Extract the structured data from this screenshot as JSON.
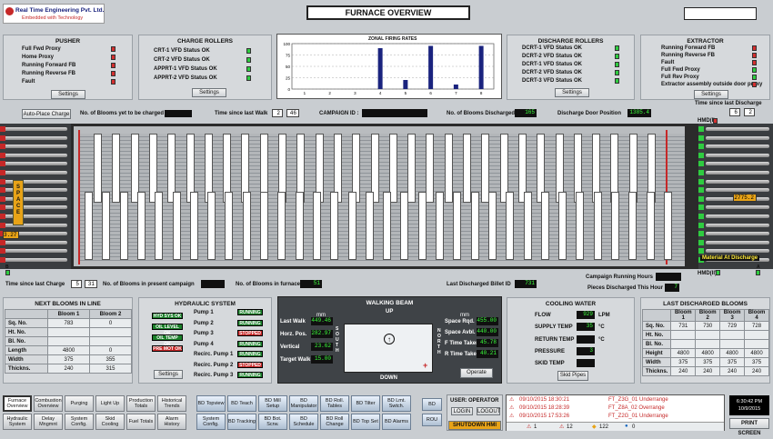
{
  "company": {
    "name": "Real Time Engineering Pvt. Ltd.",
    "tagline": "Embedded with Technology"
  },
  "page_title": "FURNACE OVERVIEW",
  "pusher": {
    "title": "PUSHER",
    "items": [
      {
        "label": "Full Fwd Proxy",
        "state": "red"
      },
      {
        "label": "Home Proxy",
        "state": "red"
      },
      {
        "label": "Running Forward FB",
        "state": "red"
      },
      {
        "label": "Running Reverse FB",
        "state": "red"
      },
      {
        "label": "Fault",
        "state": "red"
      }
    ],
    "settings": "Settings"
  },
  "charge_rollers": {
    "title": "CHARGE ROLLERS",
    "items": [
      {
        "label": "CRT-1 VFD Status OK",
        "state": "green"
      },
      {
        "label": "CRT-2 VFD Status OK",
        "state": "green"
      },
      {
        "label": "APPRT-1 VFD Status OK",
        "state": "green"
      },
      {
        "label": "APPRT-2 VFD Status OK",
        "state": "green"
      }
    ],
    "settings": "Settings"
  },
  "zonal_chart": {
    "chart_data": {
      "type": "bar",
      "title": "ZONAL FIRING RATES",
      "categories": [
        "1",
        "2",
        "3",
        "4",
        "5",
        "6",
        "7",
        "8"
      ],
      "values": [
        0,
        0,
        0,
        90,
        20,
        95,
        10,
        95
      ],
      "ylim": [
        0,
        100
      ],
      "yticks": [
        "100",
        "75",
        "50",
        "25",
        "0"
      ]
    }
  },
  "discharge_rollers": {
    "title": "DISCHARGE ROLLERS",
    "items": [
      {
        "label": "DCRT-1 VFD Status OK",
        "state": "green"
      },
      {
        "label": "DCRT-2 VFD Status OK",
        "state": "green"
      },
      {
        "label": "DCRT-1 VFD Status OK",
        "state": "green"
      },
      {
        "label": "DCRT-2 VFD Status OK",
        "state": "green"
      },
      {
        "label": "DCRT-3 VFD Status OK",
        "state": "green"
      }
    ],
    "settings": "Settings"
  },
  "extractor": {
    "title": "EXTRACTOR",
    "items": [
      {
        "label": "Running Forward FB",
        "state": "red"
      },
      {
        "label": "Running Reverse FB",
        "state": "red"
      },
      {
        "label": "Fault",
        "state": "red"
      },
      {
        "label": "Full Fwd Proxy",
        "state": "green"
      },
      {
        "label": "Full Rev Proxy",
        "state": "green"
      },
      {
        "label": "Extractor assembly outside door proxy",
        "state": "red"
      }
    ],
    "settings": "Settings"
  },
  "top_status": {
    "auto_place": "Auto-Place Charge",
    "blooms_to_charge_label": "No. of Blooms yet to be charged",
    "blooms_to_charge": "",
    "since_last_walk_label": "Time since last Walk",
    "since_last_walk_m": "2",
    "since_last_walk_s": "46",
    "campaign_id_label": "CAMPAIGN ID :",
    "campaign_id": "",
    "blooms_discharged_label": "No. of Blooms Discharged",
    "blooms_discharged": "165",
    "door_pos_label": "Discharge Door Position",
    "door_pos": "1385.4",
    "since_last_discharge_label": "Time since last Discharge",
    "since_last_discharge_m": "6",
    "since_last_discharge_s": "2"
  },
  "furnace": {
    "space_label": "SPACE",
    "left_value": "3.27",
    "right_value": "2775.2",
    "hmd_i": "HMD(I)",
    "hmd_ii": "HMD(II)",
    "material_at_discharge": "Material At Discharge",
    "a_label": "A",
    "b_label": "B"
  },
  "bottom_status": {
    "since_last_charge_label": "Time since last Charge",
    "since_last_charge_m": "5",
    "since_last_charge_s": "31",
    "blooms_campaign_label": "No. of Blooms in present campaign",
    "blooms_campaign": "",
    "blooms_furnace_label": "No. of Blooms in furnace",
    "blooms_furnace": "51",
    "last_billet_label": "Last Discharged Billet ID",
    "last_billet": "731",
    "campaign_hours_label": "Campaign Running Hours",
    "campaign_hours": "",
    "pieces_hour_label": "Pieces Discharged This Hour",
    "pieces_hour": "7"
  },
  "next_blooms": {
    "title": "NEXT BLOOMS IN LINE",
    "headers": [
      "",
      "Bloom 1",
      "Bloom 2"
    ],
    "rows": [
      [
        "Sq. No.",
        "783",
        "0"
      ],
      [
        "Ht. No.",
        "",
        ""
      ],
      [
        "Bl. No.",
        "",
        ""
      ],
      [
        "Length",
        "4800",
        "0"
      ],
      [
        "Width",
        "375",
        "355"
      ],
      [
        "Thickns.",
        "240",
        "315"
      ]
    ]
  },
  "hydraulic": {
    "title": "HYDRAULIC SYSTEM",
    "indicators": [
      {
        "label": "HYD SYS OK",
        "color": "#1b7f2a"
      },
      {
        "label": "OIL LEVEL OK",
        "color": "#1b7f2a"
      },
      {
        "label": "OIL TEMP OK",
        "color": "#1b7f2a"
      },
      {
        "label": "PRE MOT OK",
        "color": "#c62828"
      }
    ],
    "pumps": [
      {
        "label": "Pump 1",
        "status": "RUNNING",
        "color": "#1b7f2a"
      },
      {
        "label": "Pump 2",
        "status": "RUNNING",
        "color": "#1b7f2a"
      },
      {
        "label": "Pump 3",
        "status": "STOPPED",
        "color": "#c62828"
      },
      {
        "label": "Pump 4",
        "status": "RUNNING",
        "color": "#1b7f2a"
      },
      {
        "label": "Recirc. Pump 1",
        "status": "RUNNING",
        "color": "#1b7f2a"
      },
      {
        "label": "Recirc. Pump 2",
        "status": "STOPPED",
        "color": "#c62828"
      },
      {
        "label": "Recirc. Pump 3",
        "status": "RUNNING",
        "color": "#1b7f2a"
      }
    ],
    "settings": "Settings"
  },
  "walking_beam": {
    "title": "WALKING BEAM",
    "unit": "mm",
    "up": "UP",
    "down": "DOWN",
    "south": "S O U T H",
    "north": "N O R T H",
    "left": [
      {
        "label": "Last Walk",
        "value": "449.46"
      },
      {
        "label": "Horz. Pos.",
        "value": "282.97"
      },
      {
        "label": "Vertical",
        "value": "23.62"
      },
      {
        "label": "Target Walk",
        "value": "15.00"
      }
    ],
    "right": [
      {
        "label": "Space Rqd.",
        "value": "455.00"
      },
      {
        "label": "Space Avbl.",
        "value": "440.00"
      },
      {
        "label": "F Time Taken",
        "value": "45.78"
      },
      {
        "label": "R Time Taken",
        "value": "40.21"
      }
    ],
    "operate": "Operate"
  },
  "cooling_water": {
    "title": "COOLING WATER",
    "flow_label": "FLOW",
    "flow": "929",
    "flow_unit": "LPM",
    "supply_label": "SUPPLY TEMP",
    "supply": "35",
    "supply_unit": "°C",
    "return_label": "RETURN TEMP",
    "return": "",
    "return_unit": "°C",
    "pressure_label": "PRESSURE",
    "pressure": "3",
    "skid_label": "SKID TEMP",
    "skid": "",
    "skid_pipes": "Skid Pipes"
  },
  "last_discharged": {
    "title": "LAST DISCHARGED BLOOMS",
    "headers": [
      "",
      "Bloom 1",
      "Bloom 2",
      "Bloom 3",
      "Bloom 4"
    ],
    "rows": [
      [
        "Sq. No.",
        "731",
        "730",
        "729",
        "728"
      ],
      [
        "Ht. No.",
        "",
        "",
        "",
        ""
      ],
      [
        "Bl. No.",
        "",
        "",
        "",
        ""
      ],
      [
        "Height",
        "4800",
        "4800",
        "4800",
        "4800"
      ],
      [
        "Width",
        "375",
        "375",
        "375",
        "375"
      ],
      [
        "Thickns.",
        "240",
        "240",
        "240",
        "240"
      ]
    ]
  },
  "nav": {
    "row1": [
      "Furnace Overview",
      "Combustion Overview",
      "Purging",
      "Light Up",
      "Production Totals",
      "Historical Trends"
    ],
    "row2": [
      "Hydraulic System",
      "Delay Mngmnt",
      "System Config.",
      "Skid Cooling",
      "Fuel Totals",
      "Alarm History"
    ],
    "bd1": [
      "BD Topview",
      "BD Teach",
      "BD Mill Setup",
      "BD Manipulator",
      "BD Roll. Tables",
      "BD Tilter",
      "BD Lmt. Swtch."
    ],
    "bd2": [
      "System Config.",
      "BD Tracking",
      "BD Bot. Scrw.",
      "BD Schedule",
      "BD Roll Change",
      "BD Top Set",
      "BD Alarms"
    ],
    "bd": "BD",
    "rou": "ROU",
    "user_label": "USER:",
    "user": "OPERATOR",
    "login": "LOGIN",
    "logout": "LOGOUT",
    "shutdown": "SHUTDOWN HMI",
    "print": "PRINT SCREEN",
    "time": "6:30:42 PM",
    "date": "10/9/2015"
  },
  "alarms": {
    "rows": [
      {
        "datetime": "09/10/2015 18:30:21",
        "text": "FT_Z3G_01 Underrange"
      },
      {
        "datetime": "09/10/2015 18:28:39",
        "text": "FT_Z8A_02 Overrange"
      },
      {
        "datetime": "09/10/2015 17:53:26",
        "text": "FT_Z2G_01 Underrange"
      }
    ],
    "count_a": "1",
    "count_b": "12",
    "count_c": "122",
    "count_d": "0"
  }
}
